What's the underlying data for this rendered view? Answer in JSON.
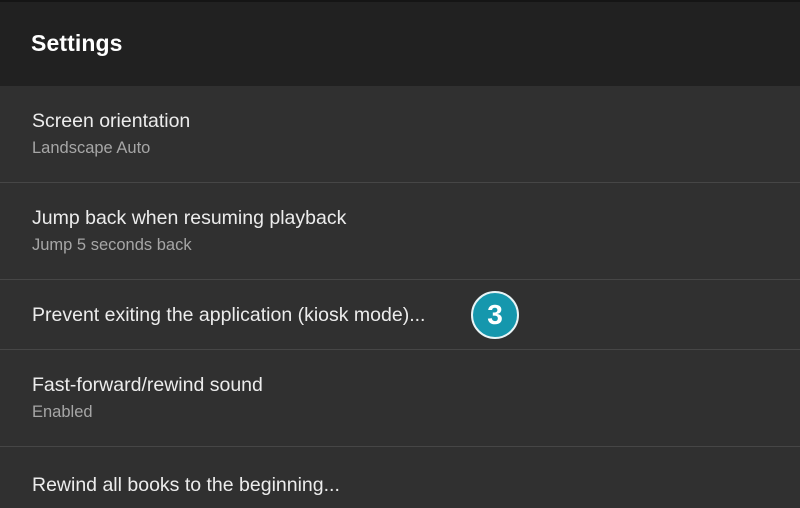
{
  "app_bar": {
    "title": "Settings"
  },
  "preferences": [
    {
      "title": "Screen orientation",
      "summary": "Landscape Auto"
    },
    {
      "title": "Jump back when resuming playback",
      "summary": "Jump 5 seconds back"
    },
    {
      "title": "Prevent exiting the application (kiosk mode)...",
      "summary": ""
    },
    {
      "title": "Fast-forward/rewind sound",
      "summary": "Enabled"
    },
    {
      "title": "Rewind all books to the beginning...",
      "summary": ""
    }
  ],
  "annotation": {
    "step_number": "3",
    "color": "#1597ad"
  },
  "colors": {
    "app_bar_bg": "#212121",
    "list_bg": "#303030",
    "divider": "#464646",
    "title_text": "#ececec",
    "summary_text": "#a6a6a6"
  }
}
